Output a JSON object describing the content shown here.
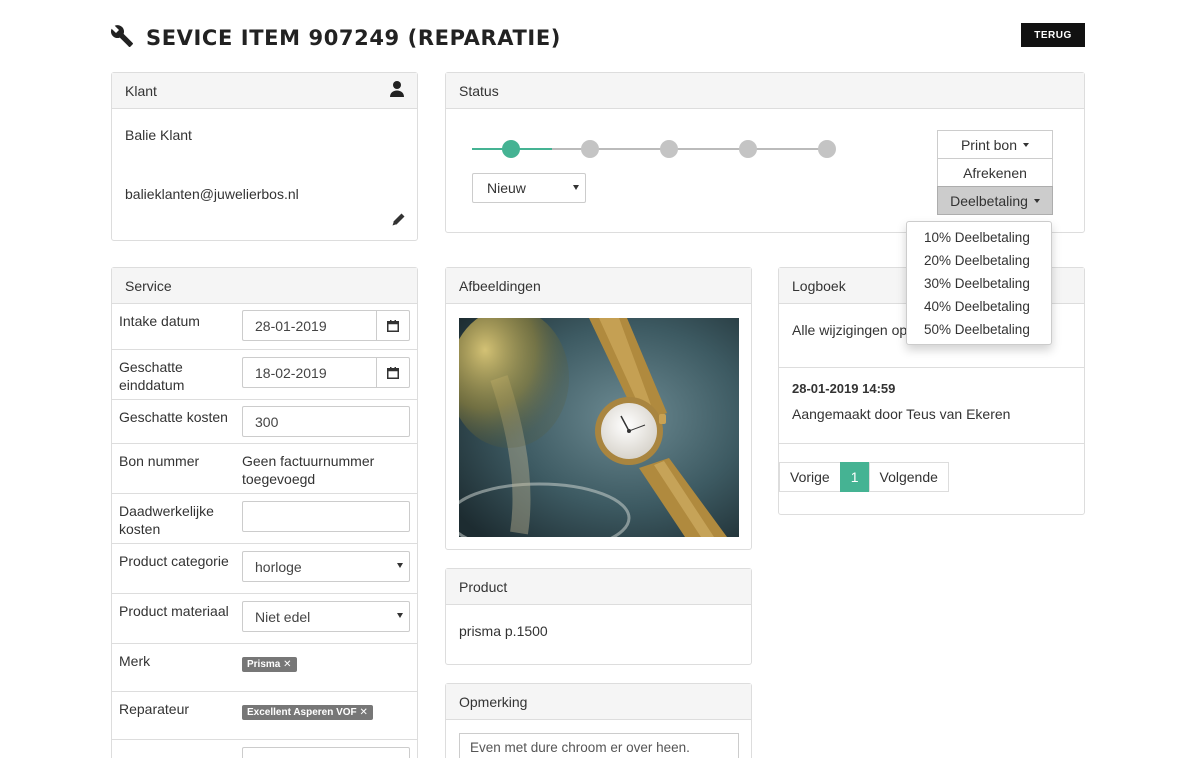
{
  "header": {
    "title": "SEVICE ITEM 907249 (REPARATIE)",
    "back_label": "TERUG",
    "title_icon": "wrench-icon"
  },
  "klant": {
    "heading": "Klant",
    "name": "Balie Klant",
    "email": "balieklanten@juwelierbos.nl",
    "icons": [
      "user-icon",
      "pencil-icon"
    ]
  },
  "status": {
    "heading": "Status",
    "steps_total": 5,
    "current_step": 1,
    "selected": "Nieuw",
    "buttons": {
      "print": "Print bon",
      "afrekenen": "Afrekenen",
      "deelbetaling": "Deelbetaling"
    },
    "dropdown_items": [
      "10% Deelbetaling",
      "20% Deelbetaling",
      "30% Deelbetaling",
      "40% Deelbetaling",
      "50% Deelbetaling"
    ]
  },
  "service": {
    "heading": "Service",
    "intake_label": "Intake datum",
    "intake_value": "28-01-2019",
    "einddatum_label": "Geschatte einddatum",
    "einddatum_value": "18-02-2019",
    "kosten_label": "Geschatte kosten",
    "kosten_value": "300",
    "bon_label": "Bon nummer",
    "bon_value": "Geen factuurnummer toegevoegd",
    "daadwerkelijk_label": "Daadwerkelijke kosten",
    "daadwerkelijk_value": "",
    "categorie_label": "Product categorie",
    "categorie_value": "horloge",
    "materiaal_label": "Product materiaal",
    "materiaal_value": "Niet edel",
    "merk_label": "Merk",
    "merk_tag": "Prisma ✕",
    "reparateur_label": "Reparateur",
    "reparateur_tag": "Excellent Asperen VOF ✕"
  },
  "afbeeldingen": {
    "heading": "Afbeeldingen"
  },
  "product": {
    "heading": "Product",
    "text": "prisma p.1500"
  },
  "opmerking": {
    "heading": "Opmerking",
    "text": "Even met dure chroom er over heen."
  },
  "logboek": {
    "heading": "Logboek",
    "line1": "Alle wijzigingen op",
    "entry_date": "28-01-2019 14:59",
    "entry_text": "Aangemaakt door Teus van Ekeren",
    "pager": {
      "prev": "Vorige",
      "page": "1",
      "next": "Volgende"
    }
  },
  "colors": {
    "accent": "#45b393",
    "inactive_step": "#c4c4c4",
    "tag": "#777777",
    "dark_button": "#111111"
  }
}
